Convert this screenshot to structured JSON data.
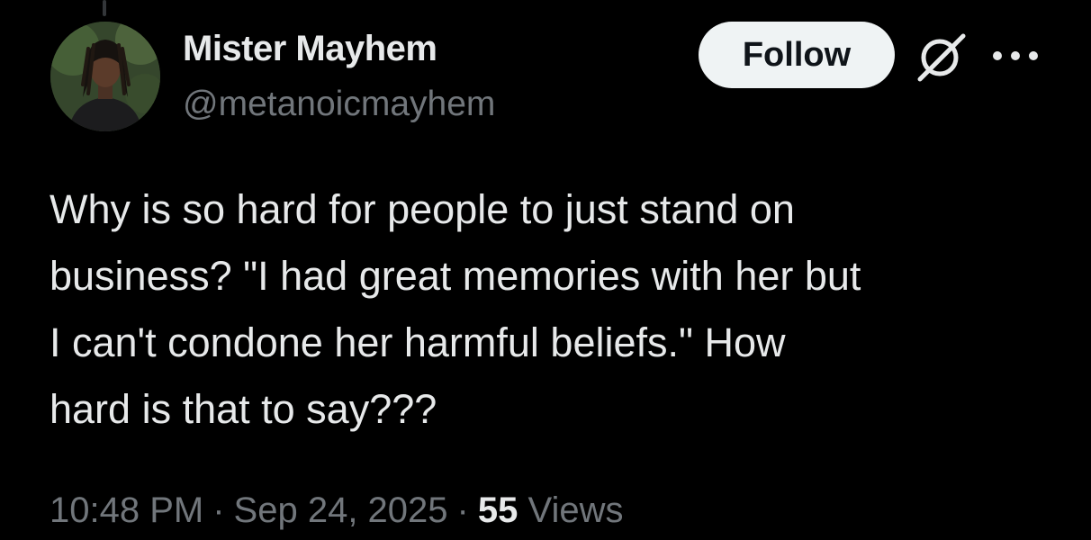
{
  "author": {
    "display_name": "Mister Mayhem",
    "handle": "@metanoicmayhem"
  },
  "actions": {
    "follow_label": "Follow",
    "grok_icon": "grok-icon",
    "more_icon": "more-icon"
  },
  "tweet": {
    "lines": [
      "Why is so hard for people to just stand on",
      "business? \"I had great memories with her but",
      "I can't condone her harmful beliefs.\" How",
      "hard is that to say???"
    ]
  },
  "meta": {
    "time": "10:48 PM",
    "separator": "·",
    "date": "Sep 24, 2025",
    "views_count": "55",
    "views_label": "Views"
  },
  "colors": {
    "background": "#000000",
    "primary_text": "#e7e9ea",
    "secondary_text": "#71767b",
    "follow_button_bg": "#eff3f4",
    "follow_button_text": "#0f1419"
  }
}
